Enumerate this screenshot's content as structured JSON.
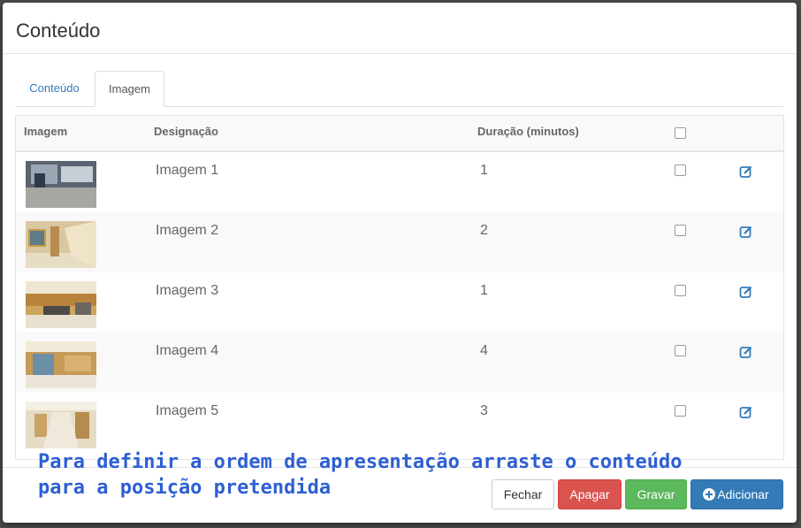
{
  "modal": {
    "title": "Conteúdo"
  },
  "tabs": [
    {
      "label": "Conteúdo",
      "active": false
    },
    {
      "label": "Imagem",
      "active": true
    }
  ],
  "table": {
    "headers": {
      "image": "Imagem",
      "designation": "Designação",
      "duration": "Duração (minutos)"
    },
    "rows": [
      {
        "name": "Imagem 1",
        "duration": "1"
      },
      {
        "name": "Imagem 2",
        "duration": "2"
      },
      {
        "name": "Imagem 3",
        "duration": "1"
      },
      {
        "name": "Imagem 4",
        "duration": "4"
      },
      {
        "name": "Imagem 5",
        "duration": "3"
      }
    ]
  },
  "hint": {
    "line1": "Para definir a ordem de apresentação arraste o conteúdo",
    "line2": "para a posição pretendida"
  },
  "buttons": {
    "close": "Fechar",
    "delete": "Apagar",
    "save": "Gravar",
    "add": "Adicionar"
  },
  "colors": {
    "link": "#337ab7",
    "danger": "#d9534f",
    "success": "#5cb85c",
    "primary": "#337ab7",
    "hint": "#2d5fd3"
  },
  "icons": {
    "edit": "edit-icon",
    "add": "plus-circle-icon"
  }
}
